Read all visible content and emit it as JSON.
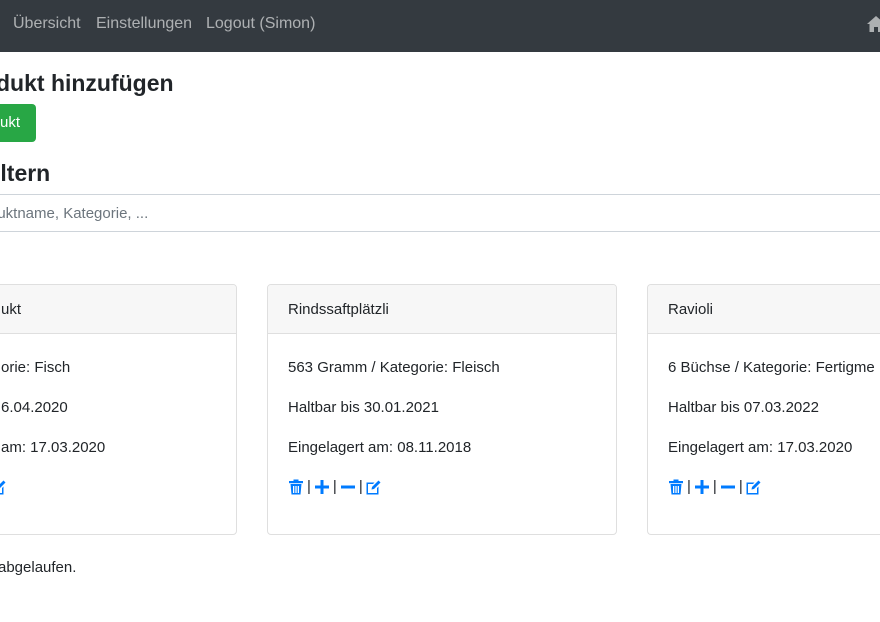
{
  "nav": {
    "links": [
      "Übersicht",
      "Einstellungen",
      "Logout (Simon)"
    ]
  },
  "add_section": {
    "heading": "dukt hinzufügen",
    "button_label": "ukt"
  },
  "filter_section": {
    "heading": "iltern",
    "placeholder": "luktname, Kategorie, ..."
  },
  "products": [
    {
      "name": "ukt",
      "line1": "orie: Fisch",
      "line2": "6.04.2020",
      "line3": "am: 17.03.2020"
    },
    {
      "name": "Rindssaftplätzli",
      "line1": "563 Gramm / Kategorie: Fleisch",
      "line2": "Haltbar bis 30.01.2021",
      "line3": "Eingelagert am: 08.11.2018"
    },
    {
      "name": "Ravioli",
      "line1": "6 Büchse / Kategorie: Fertigme",
      "line2": "Haltbar bis 07.03.2022",
      "line3": "Eingelagert am: 17.03.2020"
    }
  ],
  "actions": {
    "separator": "|",
    "icons": [
      "trash-icon",
      "plus-icon",
      "minus-icon",
      "edit-icon"
    ]
  },
  "footer": {
    "text": "abgelaufen."
  },
  "colors": {
    "navbar": "#343a40",
    "success": "#28a745",
    "primary": "#007bff"
  }
}
